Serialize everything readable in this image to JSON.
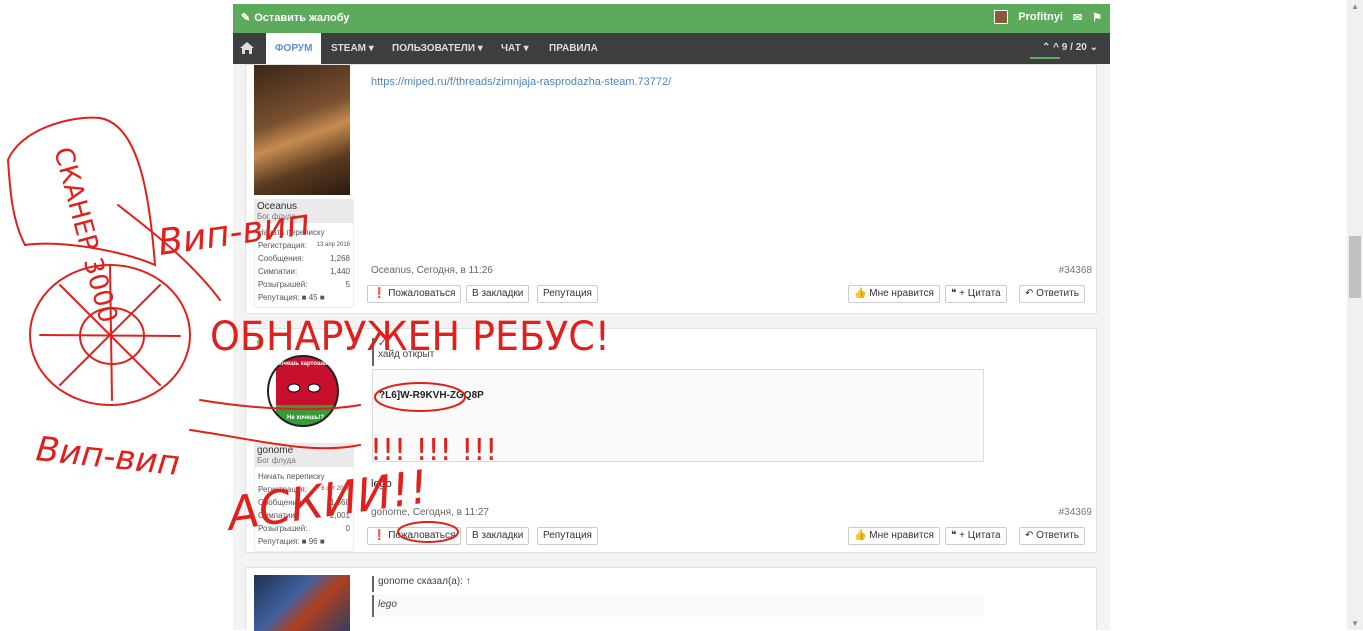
{
  "topbar": {
    "complain": "Оставить жалобу",
    "username": "Profitnyi"
  },
  "nav": {
    "items": [
      "ФОРУМ",
      "STEAM ▾",
      "ПОЛЬЗОВАТЕЛИ ▾",
      "ЧАТ ▾",
      "ПРАВИЛА"
    ],
    "counter": "9 / 20"
  },
  "post1": {
    "user": "Oceanus",
    "title": "Бог флуда",
    "stats": {
      "pm": "Начать переписку",
      "reg_label": "Регистрация:",
      "reg_value": "13 апр 2016",
      "msg_label": "Сообщения:",
      "msg_value": "1,268",
      "likes_label": "Симпатии:",
      "likes_value": "1,440",
      "giveaways_label": "Розыгрышей:",
      "giveaways_value": "5",
      "rep_label": "Репутация:",
      "rep_value": "45"
    },
    "link": "https://miped.ru/f/threads/zimnjaja-rasprodazha-steam.73772/",
    "meta": "Oceanus, Сегодня, в 11:26",
    "num": "#34368"
  },
  "post2": {
    "user": "gonome",
    "title": "Бог флуда",
    "avatar_text_top": "Хочешь картошки?",
    "avatar_text_bottom": "Не хочешь!?",
    "stats": {
      "pm": "Начать переписку",
      "reg_label": "Регистрация:",
      "reg_value": "6 окт 2016",
      "msg_label": "Сообщения:",
      "msg_value": "1,368",
      "likes_label": "Симпатии:",
      "likes_value": "2,001",
      "giveaways_label": "Розыгрышей:",
      "giveaways_value": "0",
      "rep_label": "Репутация:",
      "rep_value": "96"
    },
    "hide_check": "✓",
    "hide_title": "хайд открыт",
    "key": "?L6]W-R9KVH-ZGQ8P",
    "body": "lego",
    "meta": "gonome, Сегодня, в 11:27",
    "num": "#34369"
  },
  "post3": {
    "quote_author": "gonome сказал(а): ↑",
    "quote_text": "lego"
  },
  "buttons": {
    "report": "Пожаловаться",
    "bookmark": "В закладки",
    "rep": "Репутация",
    "like": "Мне нравится",
    "quote": "+ Цитата",
    "reply": "Ответить"
  },
  "scribbles": {
    "scanner": "СКАНЕР 3000",
    "vip1": "Вип-вип",
    "found": "ОБНАРУЖЕН РЕБУС!",
    "vip2": "Вип-вип",
    "ascii": "АСКИИ!!",
    "marks": "!!! !!! !!!"
  },
  "colors": {
    "topbar": "#5cab5c",
    "navbar": "#3e3e3e",
    "link": "#4f84bf",
    "scribble": "#e0201c"
  }
}
